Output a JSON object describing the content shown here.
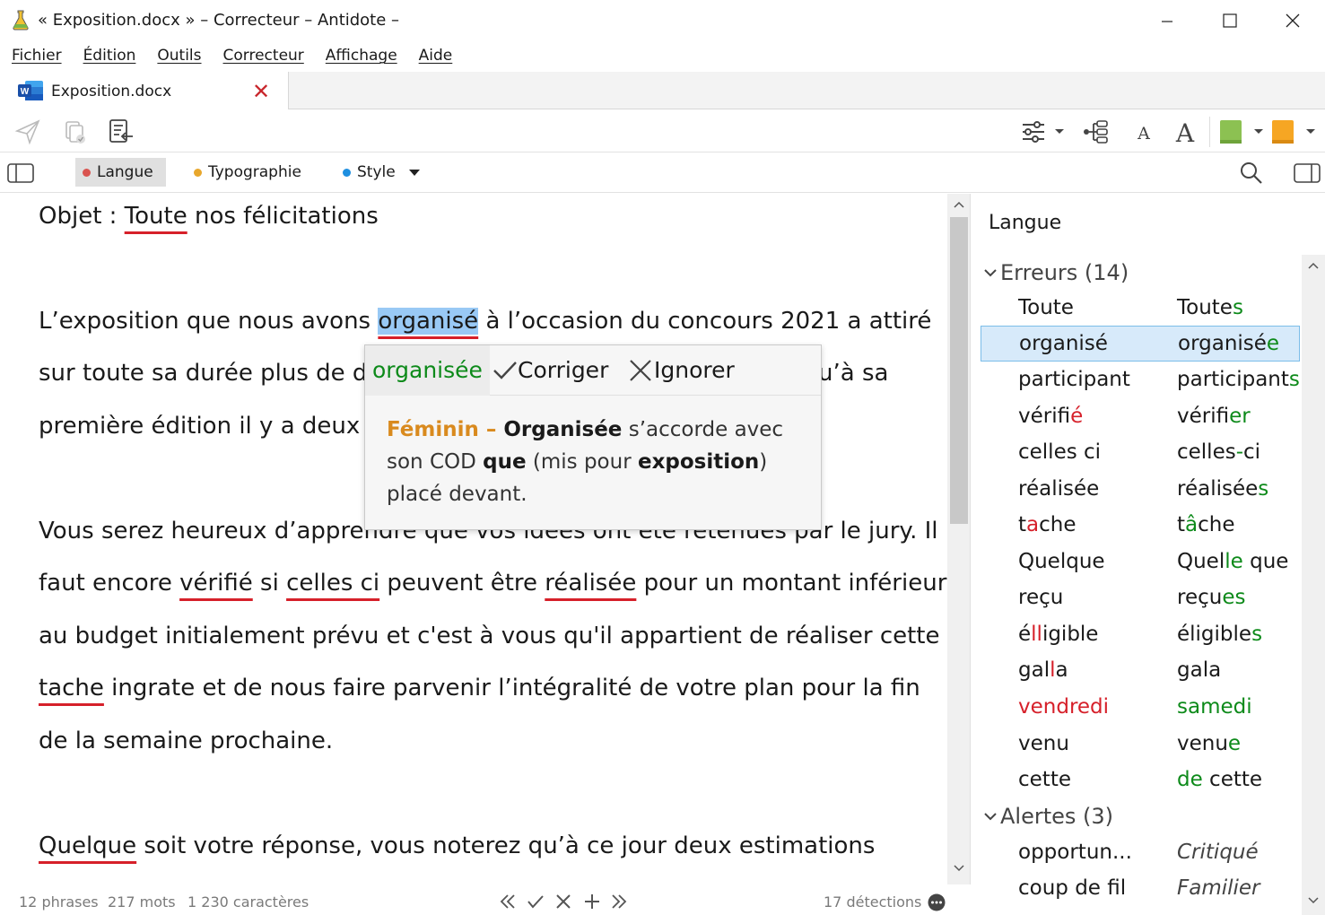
{
  "window": {
    "title": "« Exposition.docx » – Correcteur – Antidote –"
  },
  "menu": [
    "Fichier",
    "Édition",
    "Outils",
    "Correcteur",
    "Affichage",
    "Aide"
  ],
  "tab": {
    "label": "Exposition.docx",
    "close": "✕"
  },
  "filters": {
    "langue": "Langue",
    "typographie": "Typographie",
    "style": "Style"
  },
  "doc": {
    "l1a": "Objet : ",
    "l1b": "Toute",
    "l1c": " nos félicitations",
    "l2a": "L’exposition que nous avons ",
    "l2b": "organisé",
    "l2c": " à l’occasion du concours 2021 a attiré",
    "l3a": "sur toute sa durée plus de de",
    "l3b": "u’à sa",
    "l4a": "première édition il y a deux a",
    "l5": "Vous serez heureux d’apprendre que vos idées ont été  retenues par le jury. Il",
    "l6a": "faut encore ",
    "l6b": "vérifié",
    "l6c": " si ",
    "l6d": "celles ci",
    "l6e": " peuvent être ",
    "l6f": "réalisée",
    "l6g": " pour un montant  inférieur",
    "l7": "au budget initialement prévu et c'est à vous qu'il appartient de réaliser cette",
    "l8a": "tache",
    "l8b": " ingrate et de nous faire parvenir l’intégralité de votre plan pour la fin",
    "l9": "de la semaine prochaine.",
    "l10a": "Quelque",
    "l10b": " soit votre réponse, vous noterez qu’à ce jour deux estimations"
  },
  "popup": {
    "suggestion": "organisée",
    "correct": "Corriger",
    "ignore": "Ignorer",
    "fem": "Féminin – ",
    "w1": "Organisée",
    "t1": " s’accorde avec son COD ",
    "w2": "que",
    "t2": " (mis pour ",
    "w3": "exposition",
    "t3": ") placé devant."
  },
  "status": {
    "phrases": "12 phrases",
    "mots": "217 mots",
    "caracteres": "1 230 caractères",
    "detections": "17 détections"
  },
  "panel": {
    "title": "Langue",
    "errors_head": "Erreurs (14)",
    "alerts_head": "Alertes (3)",
    "errors": [
      {
        "from": "Toute",
        "to_a": "Toute",
        "to_b": "s"
      },
      {
        "from": "organisé",
        "to_a": "organisé",
        "to_b": "e"
      },
      {
        "from": "participant",
        "to_a": "participant",
        "to_b": "s"
      },
      {
        "from_a": "vérifi",
        "from_b": "é",
        "to_a": "vérifi",
        "to_b": "er"
      },
      {
        "from": "celles ci",
        "to_a": "celles",
        "to_b": "-",
        "to_c": "ci"
      },
      {
        "from": "réalisée",
        "to_a": "réalisée",
        "to_b": "s"
      },
      {
        "from_a": "t",
        "from_b": "a",
        "from_c": "che",
        "to_a": "t",
        "to_b": "â",
        "to_c": "che"
      },
      {
        "from": "Quelque",
        "to_a": "Quel",
        "to_b": "le",
        "to_c": " que"
      },
      {
        "from": "reçu",
        "to_a": "reçu",
        "to_b": "es"
      },
      {
        "from_a": "é",
        "from_b": "ll",
        "from_c": "igible",
        "to_a": "éligible",
        "to_b": "s"
      },
      {
        "from_a": "gal",
        "from_b": "l",
        "from_c": "a",
        "to": "gala"
      },
      {
        "from": "vendredi",
        "to": "samedi"
      },
      {
        "from": "venu",
        "to_a": "venu",
        "to_b": "e"
      },
      {
        "from": "cette",
        "to_a": "de",
        "to_b": " cette"
      }
    ],
    "alerts": [
      {
        "from": "opportun...",
        "to": "Critiqué"
      },
      {
        "from": "coup de fil",
        "to": "Familier"
      }
    ]
  },
  "colors": {
    "error": "#d6202a",
    "correction": "#0d8a1a",
    "selection": "#99c9f5",
    "langue_dot": "#d9534f",
    "typo_dot": "#e8a72c",
    "style_dot": "#1e8fe0"
  }
}
